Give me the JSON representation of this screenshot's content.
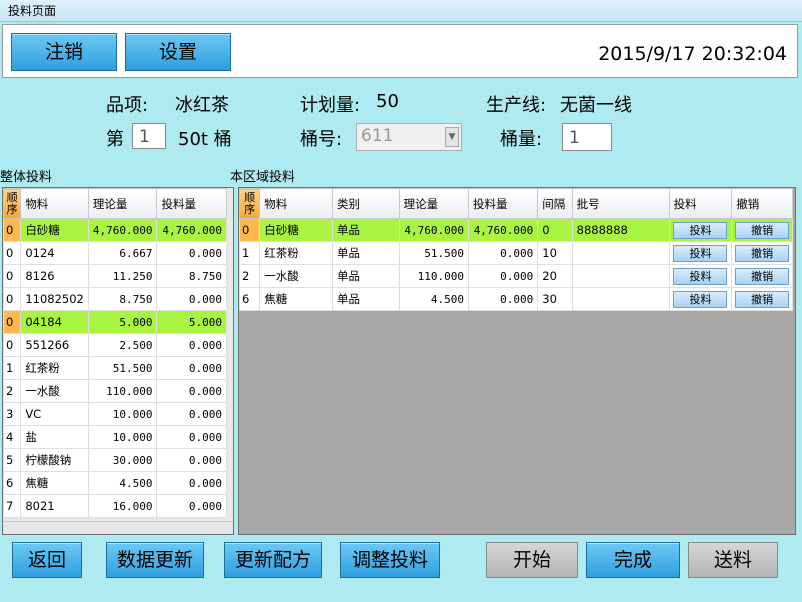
{
  "window": {
    "title": "投料页面"
  },
  "toolbar": {
    "logout_label": "注销",
    "settings_label": "设置",
    "datetime": "2015/9/17 20:32:04"
  },
  "info": {
    "product_label": "品项:",
    "product_value": "冰红茶",
    "plan_label": "计划量:",
    "plan_value": "50",
    "line_label": "生产线:",
    "line_value": "无菌一线",
    "batch_prefix": "第",
    "batch_value": "1",
    "batch_suffix": "50t 桶",
    "bucket_no_label": "桶号:",
    "bucket_no_value": "611",
    "bucket_qty_label": "桶量:",
    "bucket_qty_value": "1"
  },
  "left_grid": {
    "title": "整体投料",
    "headers": {
      "seq": "顺序",
      "material": "物料",
      "theory": "理论量",
      "fed": "投料量"
    },
    "rows": [
      {
        "seq": "0",
        "material": "白砂糖",
        "theory": "4,760.000",
        "fed": "4,760.000",
        "highlight": true
      },
      {
        "seq": "0",
        "material": "0124",
        "theory": "6.667",
        "fed": "0.000"
      },
      {
        "seq": "0",
        "material": "8126",
        "theory": "11.250",
        "fed": "8.750"
      },
      {
        "seq": "0",
        "material": "11082502",
        "theory": "8.750",
        "fed": "0.000"
      },
      {
        "seq": "0",
        "material": "04184",
        "theory": "5.000",
        "fed": "5.000",
        "highlight": true
      },
      {
        "seq": "0",
        "material": "551266",
        "theory": "2.500",
        "fed": "0.000"
      },
      {
        "seq": "1",
        "material": "红茶粉",
        "theory": "51.500",
        "fed": "0.000"
      },
      {
        "seq": "2",
        "material": "一水酸",
        "theory": "110.000",
        "fed": "0.000"
      },
      {
        "seq": "3",
        "material": "VC",
        "theory": "10.000",
        "fed": "0.000"
      },
      {
        "seq": "4",
        "material": "盐",
        "theory": "10.000",
        "fed": "0.000"
      },
      {
        "seq": "5",
        "material": "柠檬酸钠",
        "theory": "30.000",
        "fed": "0.000"
      },
      {
        "seq": "6",
        "material": "焦糖",
        "theory": "4.500",
        "fed": "0.000"
      },
      {
        "seq": "7",
        "material": "8021",
        "theory": "16.000",
        "fed": "0.000"
      }
    ]
  },
  "right_grid": {
    "title": "本区域投料",
    "headers": {
      "seq": "顺序",
      "material": "物料",
      "category": "类别",
      "theory": "理论量",
      "fed": "投料量",
      "interval": "间隔",
      "batch": "批号",
      "feed": "投料",
      "cancel": "撤销"
    },
    "feed_btn": "投料",
    "cancel_btn": "撤销",
    "rows": [
      {
        "seq": "0",
        "material": "白砂糖",
        "category": "单品",
        "theory": "4,760.000",
        "fed": "4,760.000",
        "interval": "0",
        "batch": "8888888",
        "highlight": true
      },
      {
        "seq": "1",
        "material": "红茶粉",
        "category": "单品",
        "theory": "51.500",
        "fed": "0.000",
        "interval": "10",
        "batch": ""
      },
      {
        "seq": "2",
        "material": "一水酸",
        "category": "单品",
        "theory": "110.000",
        "fed": "0.000",
        "interval": "20",
        "batch": ""
      },
      {
        "seq": "6",
        "material": "焦糖",
        "category": "单品",
        "theory": "4.500",
        "fed": "0.000",
        "interval": "30",
        "batch": ""
      }
    ]
  },
  "bottom": {
    "back": "返回",
    "refresh": "数据更新",
    "update_recipe": "更新配方",
    "adjust": "调整投料",
    "start": "开始",
    "complete": "完成",
    "send": "送料"
  }
}
